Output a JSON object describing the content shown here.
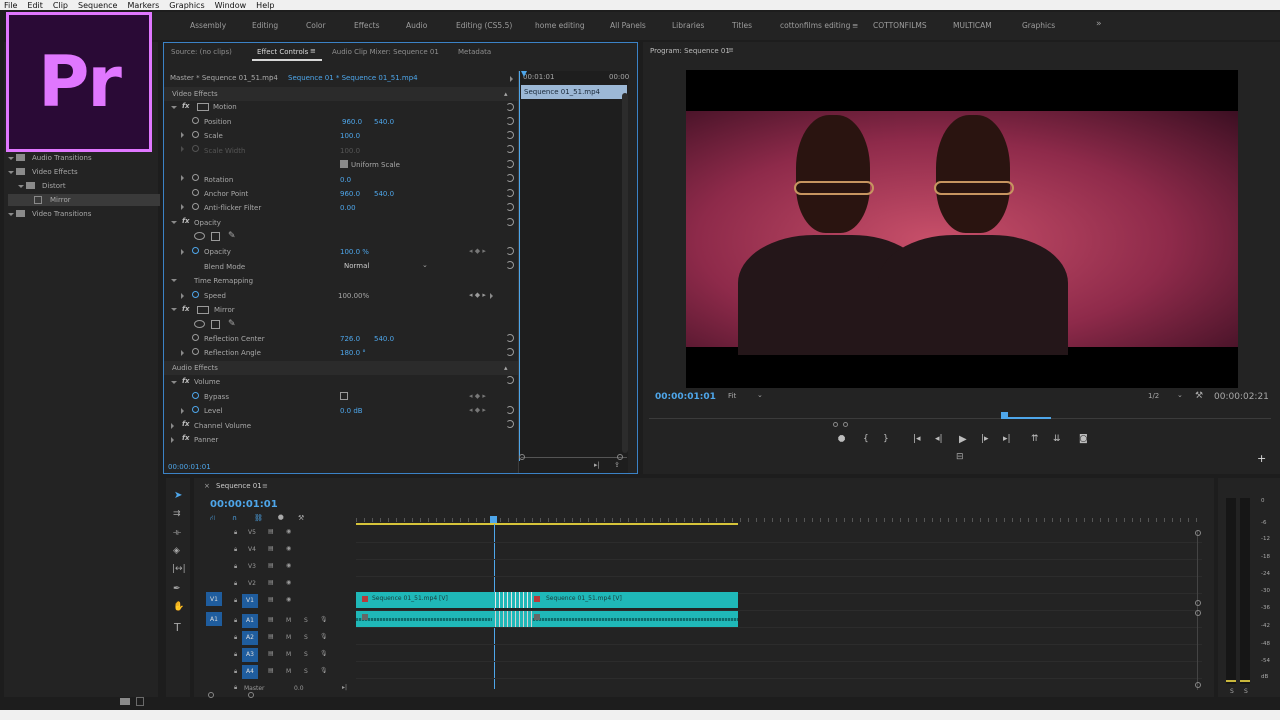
{
  "menu": [
    "File",
    "Edit",
    "Clip",
    "Sequence",
    "Markers",
    "Graphics",
    "Window",
    "Help"
  ],
  "workspaces": [
    {
      "label": "Assembly",
      "active": false
    },
    {
      "label": "Editing",
      "active": false
    },
    {
      "label": "Color",
      "active": false
    },
    {
      "label": "Effects",
      "active": false
    },
    {
      "label": "Audio",
      "active": false
    },
    {
      "label": "Editing (CS5.5)",
      "active": false
    },
    {
      "label": "home editing",
      "active": false
    },
    {
      "label": "All Panels",
      "active": false
    },
    {
      "label": "Libraries",
      "active": false
    },
    {
      "label": "Titles",
      "active": false
    },
    {
      "label": "cottonfilms editing",
      "active": true
    },
    {
      "label": "COTTONFILMS",
      "active": false
    },
    {
      "label": "MULTICAM",
      "active": false
    },
    {
      "label": "Graphics",
      "active": false
    }
  ],
  "logo": "Pr",
  "effects_tree": [
    {
      "label": "Audio Transitions",
      "level": 0
    },
    {
      "label": "Video Effects",
      "level": 0
    },
    {
      "label": "Distort",
      "level": 1
    },
    {
      "label": "Mirror",
      "level": 2
    },
    {
      "label": "Video Transitions",
      "level": 0
    }
  ],
  "effect_controls": {
    "tabs": [
      "Source: (no clips)",
      "Effect Controls",
      "Audio Clip Mixer: Sequence 01",
      "Metadata"
    ],
    "master": "Master * Sequence 01_51.mp4",
    "sequence": "Sequence 01 * Sequence 01_51.mp4",
    "tc_start": "00:01:01",
    "tc_end": "00:00",
    "clip_bar": "Sequence 01_51.mp4",
    "video_effects": "Video Effects",
    "motion": "Motion",
    "position": {
      "label": "Position",
      "x": "960.0",
      "y": "540.0"
    },
    "scale": {
      "label": "Scale",
      "value": "100.0"
    },
    "scale_width": {
      "label": "Scale Width",
      "value": "100.0"
    },
    "uniform_scale": "Uniform Scale",
    "rotation": {
      "label": "Rotation",
      "value": "0.0"
    },
    "anchor": {
      "label": "Anchor Point",
      "x": "960.0",
      "y": "540.0"
    },
    "antiflicker": {
      "label": "Anti-flicker Filter",
      "value": "0.00"
    },
    "opacity_group": "Opacity",
    "opacity": {
      "label": "Opacity",
      "value": "100.0 %"
    },
    "blend": {
      "label": "Blend Mode",
      "value": "Normal"
    },
    "time_remap": "Time Remapping",
    "speed": {
      "label": "Speed",
      "value": "100.00%"
    },
    "mirror": "Mirror",
    "reflection_center": {
      "label": "Reflection Center",
      "x": "726.0",
      "y": "540.0"
    },
    "reflection_angle": {
      "label": "Reflection Angle",
      "value": "180.0 °"
    },
    "audio_effects": "Audio Effects",
    "volume": "Volume",
    "bypass": "Bypass",
    "level": {
      "label": "Level",
      "value": "0.0 dB"
    },
    "channel_volume": "Channel Volume",
    "panner": "Panner",
    "footer_tc": "00:00:01:01"
  },
  "program": {
    "title": "Program: Sequence 01",
    "timecode": "00:00:01:01",
    "fit": "Fit",
    "resolution": "1/2",
    "duration": "00:00:02:21"
  },
  "timeline": {
    "tab": "Sequence 01",
    "timecode": "00:00:01:01",
    "video_tracks": [
      "V5",
      "V4",
      "V3",
      "V2",
      "V1"
    ],
    "audio_tracks": [
      "A1",
      "A2",
      "A3",
      "A4"
    ],
    "master": "Master",
    "master_value": "0.0",
    "source_v": "V1",
    "source_a": "A1",
    "clips": [
      {
        "label": "Sequence 01_51.mp4 [V]"
      },
      {
        "label": "Sequence 01_51.mp4 [V]"
      }
    ]
  },
  "meter": {
    "labels": [
      "0",
      "-6",
      "-12",
      "-18",
      "-24",
      "-30",
      "-36",
      "-42",
      "-48",
      "-54",
      "dB"
    ],
    "solo": [
      "S",
      "S"
    ]
  },
  "colors": {
    "accent": "#4ea6ea",
    "clip": "#1fb8b8",
    "logo": "#e077ff"
  }
}
